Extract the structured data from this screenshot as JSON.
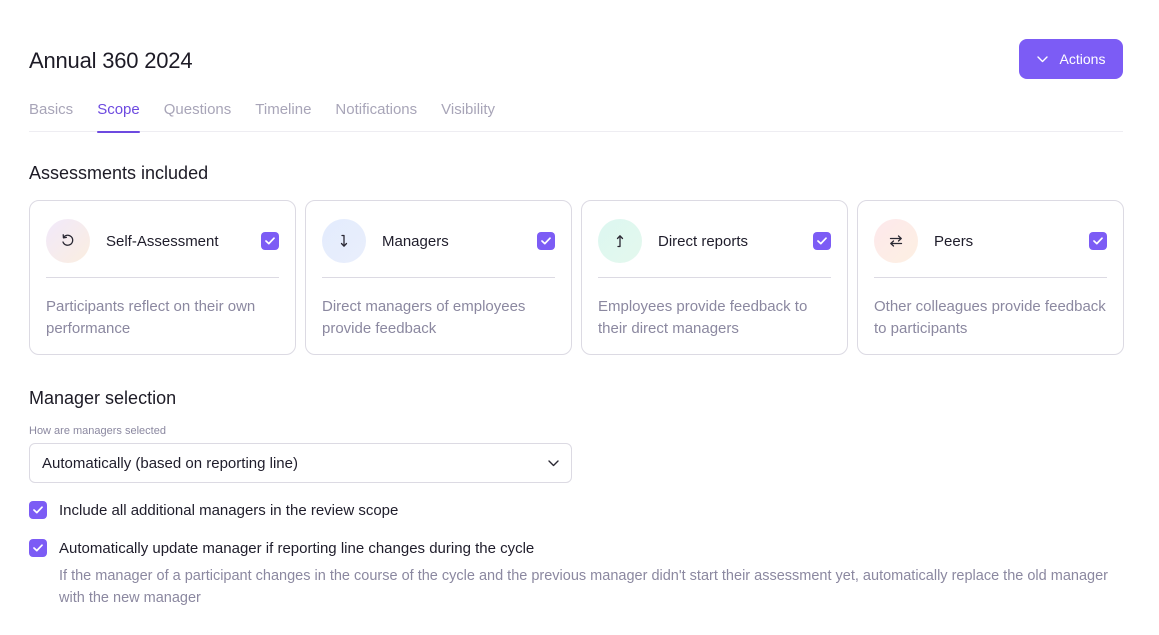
{
  "header": {
    "title": "Annual 360 2024",
    "actions_label": "Actions"
  },
  "tabs": [
    {
      "label": "Basics",
      "active": false
    },
    {
      "label": "Scope",
      "active": true
    },
    {
      "label": "Questions",
      "active": false
    },
    {
      "label": "Timeline",
      "active": false
    },
    {
      "label": "Notifications",
      "active": false
    },
    {
      "label": "Visibility",
      "active": false
    }
  ],
  "assessments": {
    "title": "Assessments included",
    "cards": [
      {
        "label": "Self-Assessment",
        "description": "Participants reflect on their own performance",
        "checked": true,
        "icon": "rotate-ccw-icon"
      },
      {
        "label": "Managers",
        "description": "Direct managers of employees provide feedback",
        "checked": true,
        "icon": "arrow-down-icon"
      },
      {
        "label": "Direct reports",
        "description": "Employees provide feedback to their direct managers",
        "checked": true,
        "icon": "arrow-up-icon"
      },
      {
        "label": "Peers",
        "description": "Other colleagues provide feedback to participants",
        "checked": true,
        "icon": "arrows-swap-icon"
      }
    ]
  },
  "manager_selection": {
    "title": "Manager selection",
    "field_label": "How are managers selected",
    "selected_value": "Automatically (based on reporting line)",
    "option_additional": "Include all additional managers in the review scope",
    "option_auto_update": "Automatically update manager if reporting line changes during the cycle",
    "option_auto_update_help": "If the manager of a participant changes in the course of the cycle and the previous manager didn't start their assessment yet, automatically replace the old manager with the new manager"
  },
  "colors": {
    "accent": "#7c5cf5",
    "tab_active": "#6d4ae0",
    "muted_text": "#8b88a0"
  }
}
